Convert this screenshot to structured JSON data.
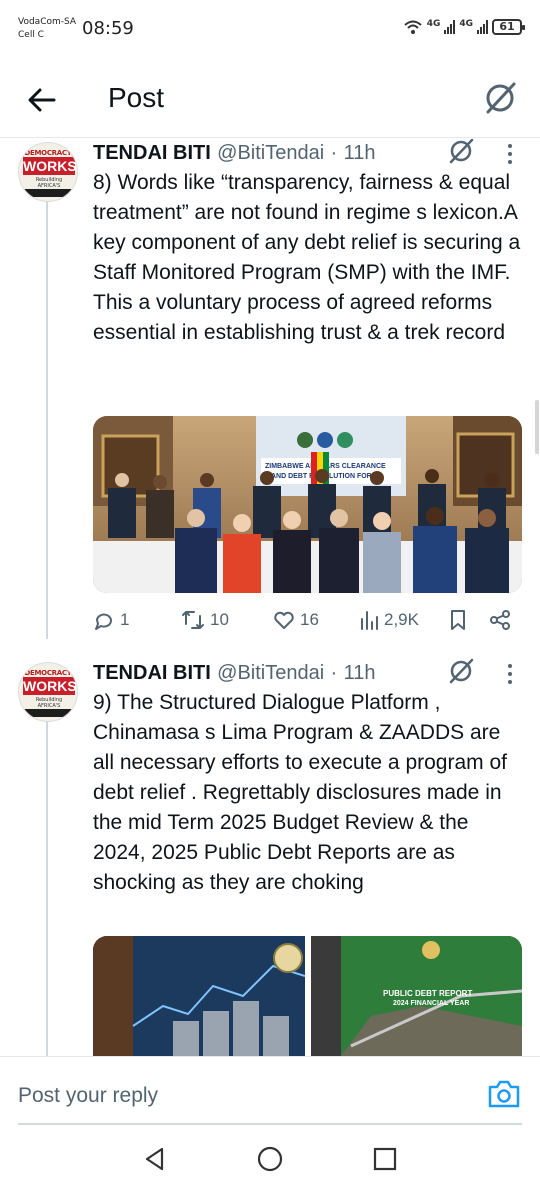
{
  "status_bar": {
    "carrier_line1": "VodaCom-SA",
    "carrier_line2": "Cell C",
    "time": "08:59",
    "network1": "4G",
    "network2": "4G",
    "battery": "61"
  },
  "header": {
    "title": "Post",
    "back_icon": "arrow-left-icon",
    "grok_icon": "grok-icon"
  },
  "posts": [
    {
      "author_name": "TENDAI BITI",
      "handle": "@BitiTendai",
      "separator": "·",
      "time": "11h",
      "avatar_top": "DEMOCRACY",
      "avatar_main": "WORKS",
      "avatar_sub": "Rebuilding AFRICA'S DEMOCRACIES",
      "text": "8) Words like “transparency, fairness & equal treatment” are not found in regime s lexicon.A key component of any debt relief is securing a Staff Monitored Program (SMP) with the IMF. This a voluntary process of agreed reforms essential in establishing trust & a trek record",
      "media_banner_line1": "ZIMBABWE ARREARS CLEARANCE",
      "media_banner_line2": "AND DEBT RESOLUTION FORUM",
      "replies": "1",
      "reposts": "10",
      "likes": "16",
      "views": "2,9K"
    },
    {
      "author_name": "TENDAI BITI",
      "handle": "@BitiTendai",
      "separator": "·",
      "time": "11h",
      "avatar_top": "DEMOCRACY",
      "avatar_main": "WORKS",
      "avatar_sub": "Rebuilding AFRICA'S DEMOCRACIES",
      "text": "9) The Structured Dialogue Platform , Chinamasa s Lima Program & ZAADDS are all necessary efforts to execute a program of debt relief . Regrettably disclosures made in the mid Term 2025 Budget Review & the 2024, 2025 Public Debt Reports are as shocking as they are choking",
      "media2_title_line1": "PUBLIC DEBT REPORT",
      "media2_title_line2": "2024 FINANCIAL YEAR"
    }
  ],
  "reply_bar": {
    "placeholder": "Post your reply",
    "camera_icon": "camera-icon"
  },
  "nav": {
    "back_icon": "triangle-back-icon",
    "home_icon": "circle-home-icon",
    "recents_icon": "square-recents-icon"
  },
  "colors": {
    "accent": "#1d9bf0",
    "text": "#0f1419",
    "muted": "#536471"
  }
}
